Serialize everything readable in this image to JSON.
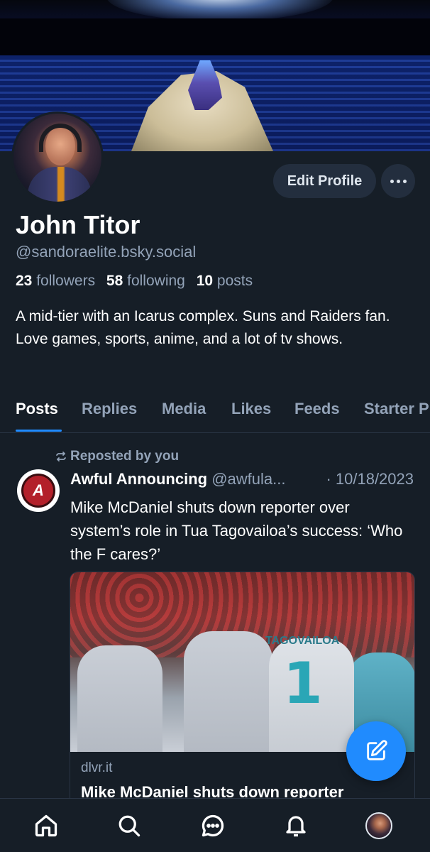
{
  "profile": {
    "name": "John Titor",
    "handle": "@sandoraelite.bsky.social",
    "followers_count": "23",
    "followers_label": "followers",
    "following_count": "58",
    "following_label": "following",
    "posts_count": "10",
    "posts_label": "posts",
    "bio": "A mid-tier with an Icarus complex. Suns and Raiders fan. Love games, sports, anime, and a lot of tv shows."
  },
  "actions": {
    "edit_profile_label": "Edit Profile"
  },
  "tabs": [
    {
      "label": "Posts",
      "active": true
    },
    {
      "label": "Replies",
      "active": false
    },
    {
      "label": "Media",
      "active": false
    },
    {
      "label": "Likes",
      "active": false
    },
    {
      "label": "Feeds",
      "active": false
    },
    {
      "label": "Starter P",
      "active": false
    }
  ],
  "post": {
    "repost_label": "Reposted by you",
    "author": "Awful Announcing",
    "author_handle": "@awfula...",
    "date": "· 10/18/2023",
    "avatar_letters": "A",
    "text": "Mike McDaniel shuts down reporter over system’s role in Tua Tagovailoa’s success: ‘Who the F cares?’",
    "link_card": {
      "image_jersey_name": "TAGOVAILOA",
      "image_jersey_number": "1",
      "domain": "dlvr.it",
      "title": "Mike McDaniel shuts down reporter"
    }
  },
  "nav": {
    "items": [
      "home-icon",
      "search-icon",
      "chat-icon",
      "bell-icon",
      "profile-avatar"
    ]
  },
  "colors": {
    "background": "#161e27",
    "accent": "#208bfe",
    "muted_text": "#93a3b8",
    "button_bg": "#232e3e"
  }
}
